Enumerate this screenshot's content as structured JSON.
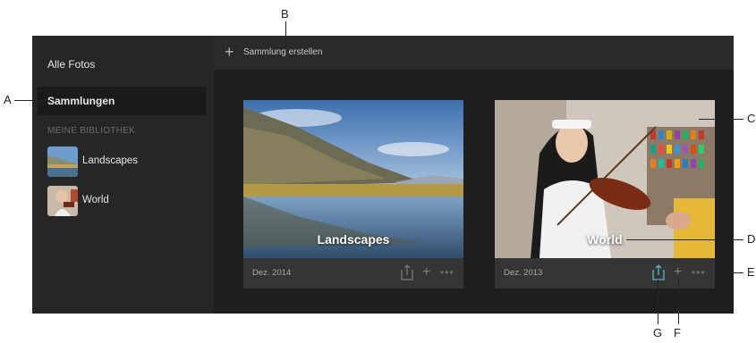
{
  "sidebar": {
    "all_photos": "Alle Fotos",
    "collections": "Sammlungen",
    "library_heading": "MEINE BIBLIOTHEK",
    "library_items": [
      {
        "label": "Landscapes",
        "thumb": "landscape-thumb"
      },
      {
        "label": "World",
        "thumb": "violinist-thumb"
      }
    ]
  },
  "topbar": {
    "create_icon": "plus-icon",
    "create_label": "Sammlung erstellen"
  },
  "collections": [
    {
      "title": "Landscapes",
      "date": "Dez. 2014",
      "icons": [
        "share-icon",
        "plus-icon",
        "more-icon"
      ]
    },
    {
      "title": "World",
      "date": "Dez. 2013",
      "icons": [
        "share-icon",
        "plus-icon",
        "more-icon"
      ]
    }
  ],
  "callouts": {
    "A": "A",
    "B": "B",
    "C": "C",
    "D": "D",
    "E": "E",
    "F": "F",
    "G": "G"
  },
  "colors": {
    "app_bg": "#1e1e1e",
    "sidebar_bg": "#262626",
    "card_bg": "#353535",
    "accent_share": "#5fb3c7"
  }
}
